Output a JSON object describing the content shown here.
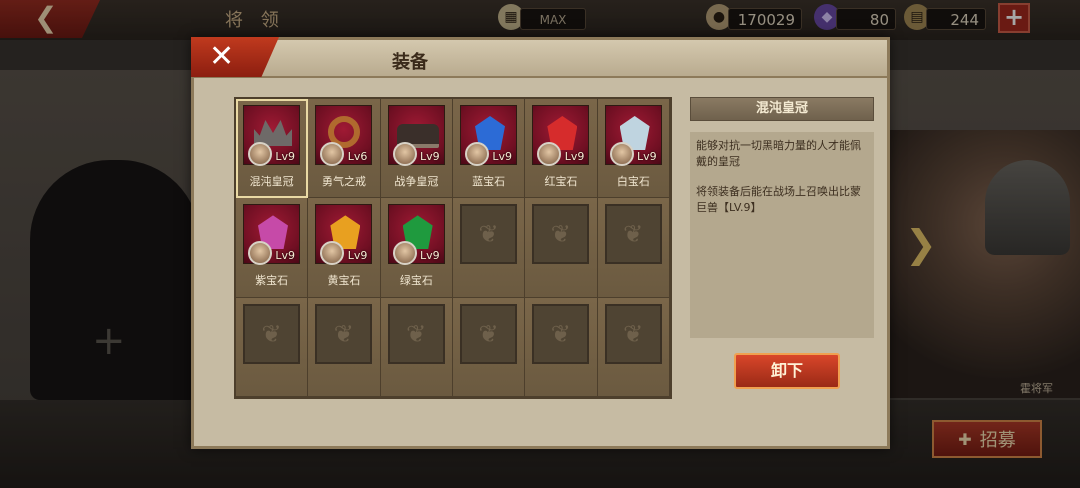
{
  "topbar": {
    "title": "将 领",
    "max_label": "MAX",
    "gold": "170029",
    "gems": "80",
    "food": "244",
    "add_icon": "plus-icon"
  },
  "hero": {
    "name": "霍将军"
  },
  "recruit_label": "招募",
  "dialog": {
    "title": "装备",
    "items": [
      {
        "label": "混沌皇冠",
        "level": "Lv9",
        "kind": "crown",
        "color": "#6e6a68"
      },
      {
        "label": "勇气之戒",
        "level": "Lv6",
        "kind": "ring",
        "color": "#b06a2e"
      },
      {
        "label": "战争皇冠",
        "level": "Lv9",
        "kind": "war-crown",
        "color": "#3a2f2a"
      },
      {
        "label": "蓝宝石",
        "level": "Lv9",
        "kind": "gem",
        "color": "#2c6bd6"
      },
      {
        "label": "红宝石",
        "level": "Lv9",
        "kind": "gem",
        "color": "#d62c2c"
      },
      {
        "label": "白宝石",
        "level": "Lv9",
        "kind": "gem",
        "color": "#bfd4e0"
      },
      {
        "label": "紫宝石",
        "level": "Lv9",
        "kind": "gem",
        "color": "#c64aa8"
      },
      {
        "label": "黄宝石",
        "level": "Lv9",
        "kind": "gem",
        "color": "#e8a020"
      },
      {
        "label": "绿宝石",
        "level": "Lv9",
        "kind": "gem",
        "color": "#1f9a3e"
      }
    ],
    "detail": {
      "name": "混沌皇冠",
      "desc1": "能够对抗一切黑暗力量的人才能佩戴的皇冠",
      "desc2": "将领装备后能在战场上召唤出比蒙巨兽【LV.9】"
    },
    "unequip_label": "卸下"
  }
}
